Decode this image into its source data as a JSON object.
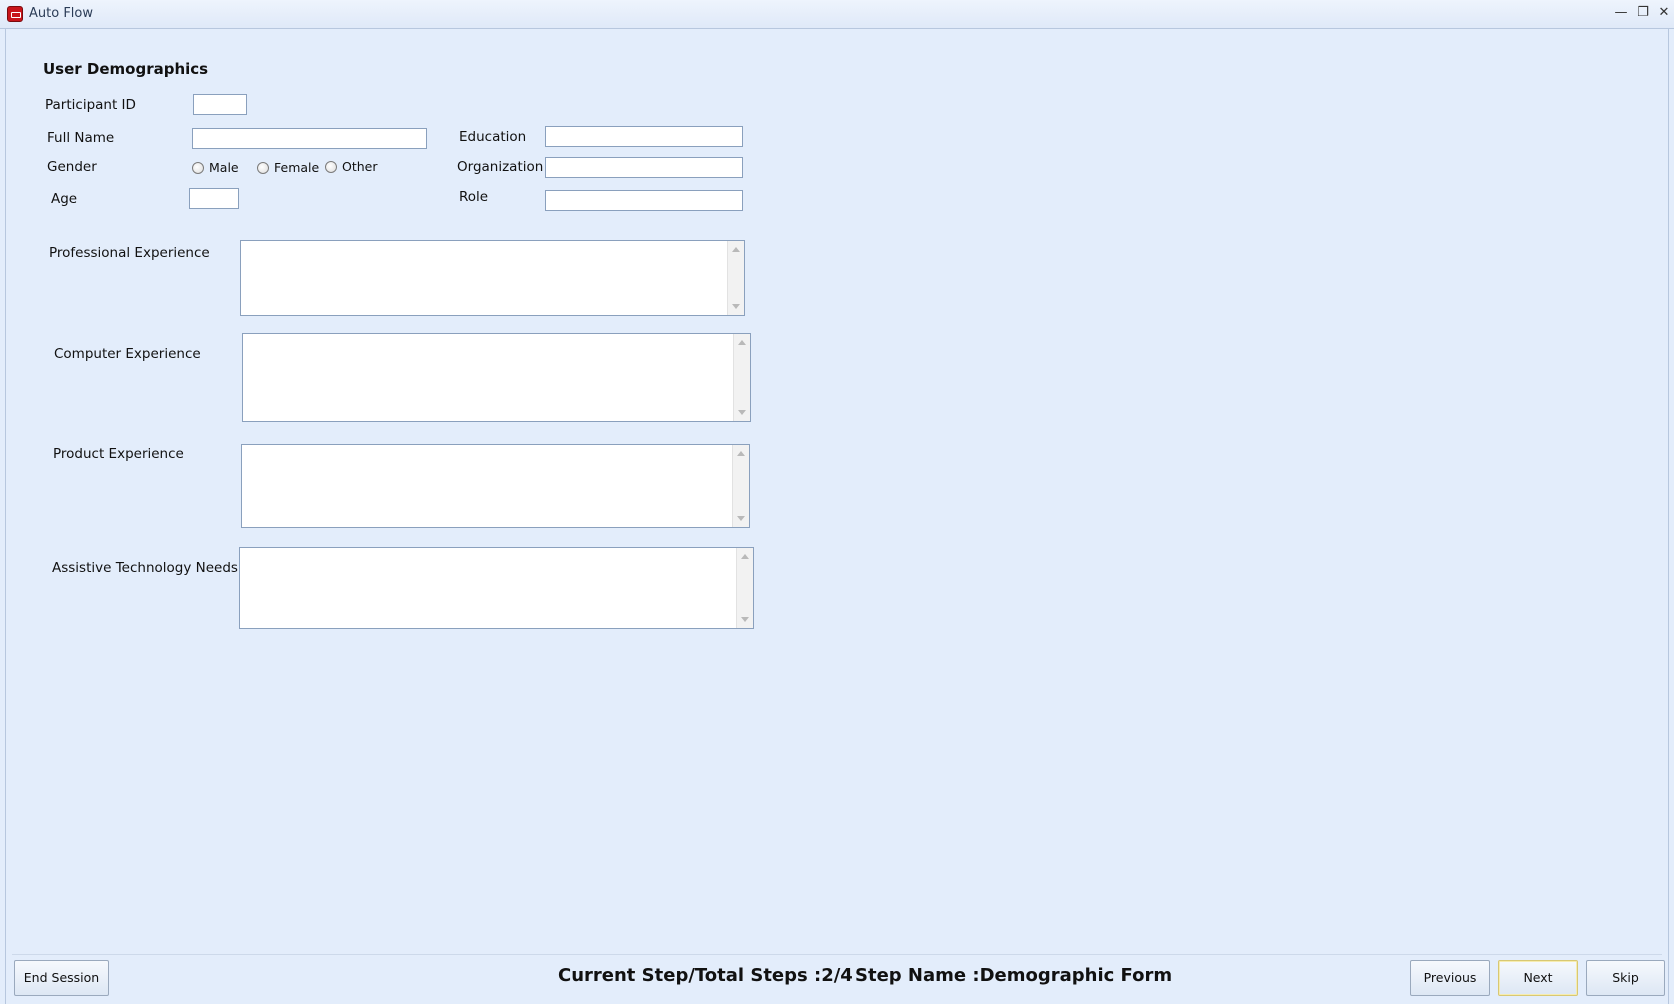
{
  "window": {
    "title": "Auto Flow",
    "icons": [
      "app-icon",
      "minimize-icon",
      "restore-icon",
      "close-icon"
    ]
  },
  "form": {
    "heading": "User Demographics",
    "participant_id_label": "Participant ID",
    "participant_id_value": "",
    "full_name_label": "Full Name",
    "full_name_value": "",
    "gender_label": "Gender",
    "gender_options": [
      "Male",
      "Female",
      "Other"
    ],
    "age_label": "Age",
    "age_value": "",
    "education_label": "Education",
    "education_value": "",
    "organization_label": "Organization",
    "organization_value": "",
    "role_label": "Role",
    "role_value": "",
    "professional_experience_label": "Professional Experience",
    "computer_experience_label": "Computer Experience",
    "product_experience_label": "Product Experience",
    "assistive_technology_label": "Assistive Technology Needs"
  },
  "footer": {
    "end_session_label": "End Session",
    "current_step_text": "Current Step/Total Steps :2/4",
    "step_name_text": "Step Name :Demographic Form",
    "previous_label": "Previous",
    "next_label": "Next",
    "skip_label": "Skip"
  }
}
